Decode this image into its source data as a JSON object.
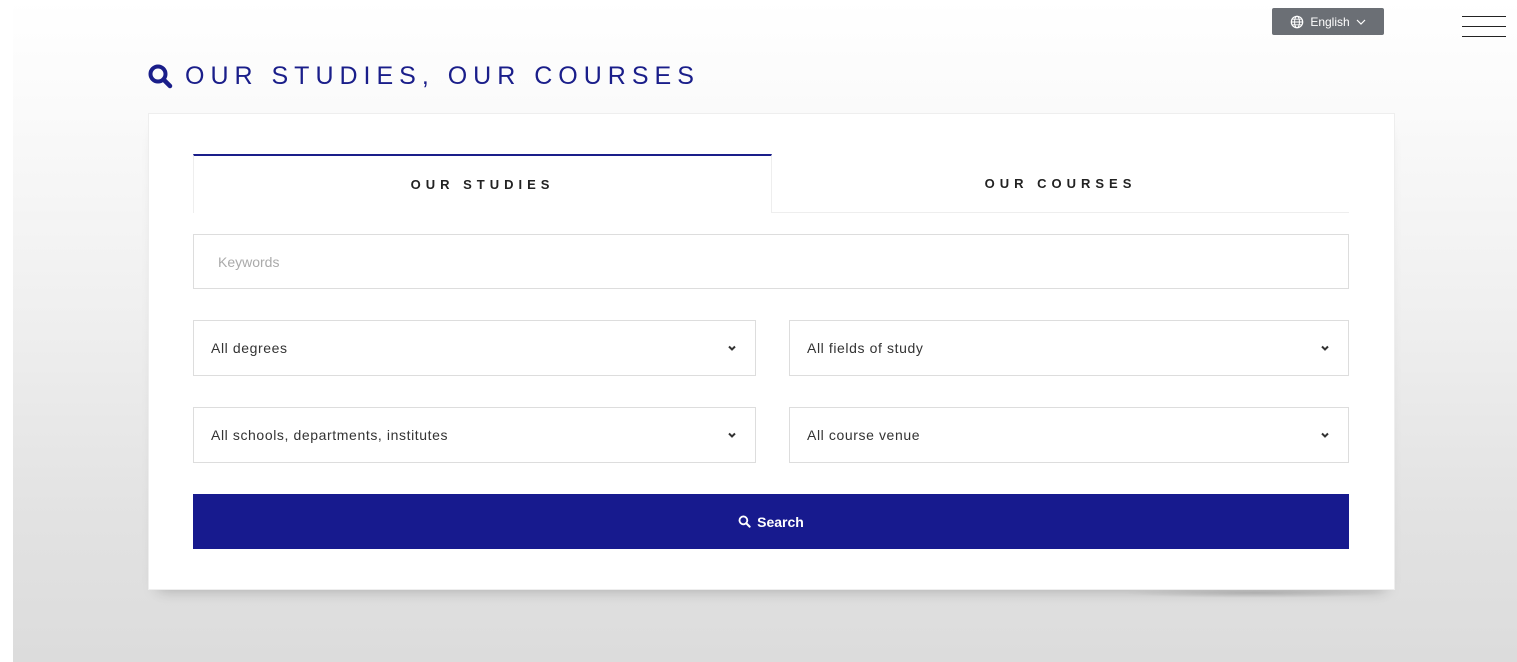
{
  "header": {
    "language": "English",
    "language_icon": "globe-icon",
    "menu_icon": "hamburger-menu-icon"
  },
  "page": {
    "title": "OUR STUDIES, OUR COURSES",
    "title_icon": "search-icon",
    "accent_color": "#1a1e8a"
  },
  "tabs": [
    {
      "label": "OUR STUDIES",
      "active": true
    },
    {
      "label": "OUR COURSES",
      "active": false
    }
  ],
  "form": {
    "keywords_placeholder": "Keywords",
    "keywords_value": "",
    "degrees_selected": "All degrees",
    "fields_selected": "All fields of study",
    "schools_selected": "All schools, departments, institutes",
    "venue_selected": "All course venue",
    "search_label": "Search",
    "search_color": "#171a8e"
  }
}
